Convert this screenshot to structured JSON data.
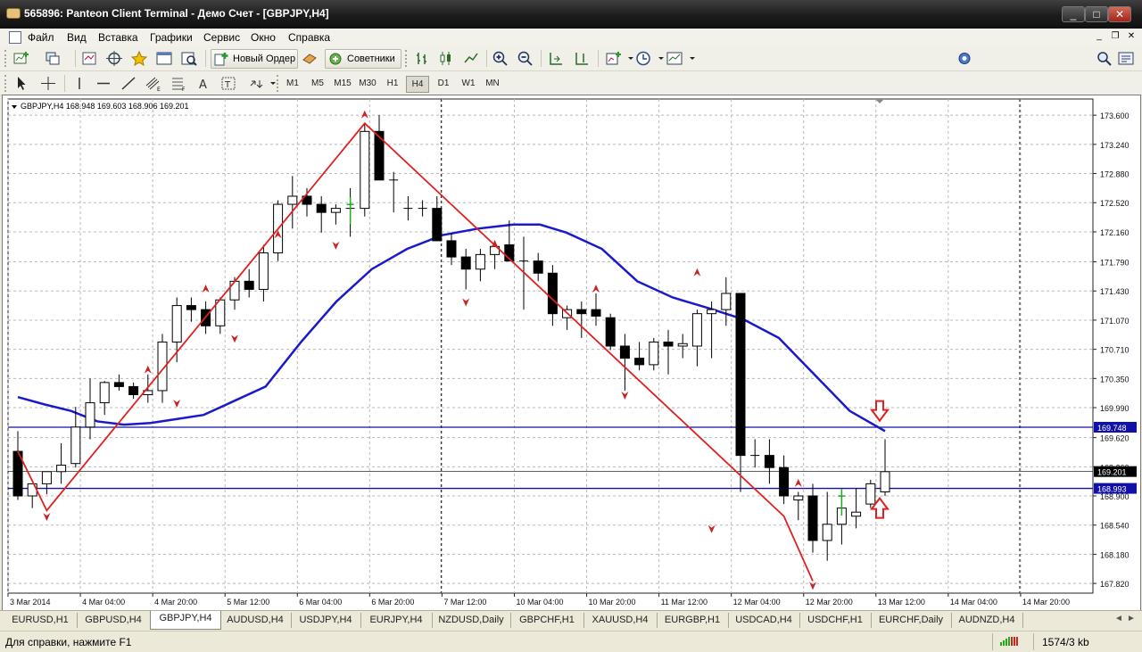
{
  "window": {
    "title": "565896: Panteon Client Terminal - Демо Счет - [GBPJPY,H4]"
  },
  "menu": [
    "Файл",
    "Вид",
    "Вставка",
    "Графики",
    "Сервис",
    "Окно",
    "Справка"
  ],
  "toolbar": {
    "new_order": "Новый Ордер",
    "experts": "Советники",
    "timeframes": [
      "M1",
      "M5",
      "M15",
      "M30",
      "H1",
      "H4",
      "D1",
      "W1",
      "MN"
    ],
    "active_timeframe": "H4"
  },
  "chart": {
    "header": "GBPJPY,H4  168.948 169.603 168.906 169.201",
    "ylim": [
      167.7,
      173.8
    ],
    "y_ticks": [
      "173.600",
      "173.240",
      "172.880",
      "172.520",
      "172.160",
      "171.790",
      "171.430",
      "171.070",
      "170.710",
      "170.350",
      "169.990",
      "169.620",
      "169.260",
      "168.900",
      "168.540",
      "168.180",
      "167.820"
    ],
    "x_ticks": [
      "3 Mar 2014",
      "4 Mar 04:00",
      "4 Mar 20:00",
      "5 Mar 12:00",
      "6 Mar 04:00",
      "6 Mar 20:00",
      "7 Mar 12:00",
      "10 Mar 04:00",
      "10 Mar 20:00",
      "11 Mar 12:00",
      "12 Mar 04:00",
      "12 Mar 20:00",
      "13 Mar 12:00",
      "14 Mar 04:00",
      "14 Mar 20:00"
    ],
    "level_lines": [
      {
        "price": 169.748,
        "label": "169.748",
        "color": "#1111aa"
      },
      {
        "price": 168.993,
        "label": "168.993",
        "color": "#1111aa"
      },
      {
        "price": 169.201,
        "label": "169.201",
        "color": "#000000"
      }
    ],
    "candles": [
      [
        169.45,
        169.7,
        168.85,
        168.9
      ],
      [
        168.9,
        169.05,
        168.75,
        169.05
      ],
      [
        169.05,
        169.2,
        168.92,
        169.2
      ],
      [
        169.2,
        169.55,
        169.05,
        169.28
      ],
      [
        169.3,
        170.0,
        169.25,
        169.75
      ],
      [
        169.75,
        170.35,
        169.6,
        170.05
      ],
      [
        170.05,
        170.32,
        169.9,
        170.3
      ],
      [
        170.3,
        170.4,
        170.2,
        170.25
      ],
      [
        170.25,
        170.3,
        170.1,
        170.15
      ],
      [
        170.15,
        170.4,
        170.05,
        170.2
      ],
      [
        170.2,
        170.9,
        170.05,
        170.8
      ],
      [
        170.8,
        171.35,
        170.55,
        171.25
      ],
      [
        171.25,
        171.35,
        171.05,
        171.2
      ],
      [
        171.2,
        171.3,
        170.9,
        171.0
      ],
      [
        171.0,
        171.35,
        170.9,
        171.32
      ],
      [
        171.32,
        171.6,
        171.2,
        171.55
      ],
      [
        171.55,
        171.7,
        171.35,
        171.45
      ],
      [
        171.45,
        172.0,
        171.3,
        171.9
      ],
      [
        171.9,
        172.55,
        171.8,
        172.5
      ],
      [
        172.5,
        172.85,
        172.2,
        172.6
      ],
      [
        172.6,
        172.7,
        172.35,
        172.5
      ],
      [
        172.5,
        172.6,
        172.15,
        172.4
      ],
      [
        172.4,
        172.5,
        172.25,
        172.45
      ],
      [
        172.45,
        172.7,
        172.1,
        172.45
      ],
      [
        172.45,
        173.5,
        172.35,
        173.4
      ],
      [
        173.4,
        173.6,
        172.9,
        172.8
      ],
      [
        172.8,
        172.9,
        172.4,
        172.8
      ],
      [
        172.45,
        172.6,
        172.3,
        172.45
      ],
      [
        172.45,
        172.55,
        172.35,
        172.45
      ],
      [
        172.45,
        172.6,
        172.05,
        172.05
      ],
      [
        172.05,
        172.15,
        171.75,
        171.85
      ],
      [
        171.85,
        171.95,
        171.45,
        171.7
      ],
      [
        171.7,
        171.95,
        171.55,
        171.88
      ],
      [
        171.88,
        172.05,
        171.7,
        171.98
      ],
      [
        172.0,
        172.3,
        171.85,
        171.8
      ],
      [
        171.8,
        172.1,
        171.2,
        171.8
      ],
      [
        171.8,
        171.9,
        171.55,
        171.65
      ],
      [
        171.65,
        171.75,
        171.0,
        171.15
      ],
      [
        171.1,
        171.25,
        170.95,
        171.2
      ],
      [
        171.2,
        171.3,
        170.85,
        171.15
      ],
      [
        171.2,
        171.4,
        171.0,
        171.12
      ],
      [
        171.1,
        171.15,
        170.7,
        170.75
      ],
      [
        170.75,
        170.9,
        170.2,
        170.6
      ],
      [
        170.6,
        170.8,
        170.45,
        170.52
      ],
      [
        170.52,
        170.85,
        170.45,
        170.8
      ],
      [
        170.8,
        170.95,
        170.4,
        170.75
      ],
      [
        170.75,
        170.9,
        170.6,
        170.78
      ],
      [
        170.75,
        171.2,
        170.5,
        171.15
      ],
      [
        171.15,
        171.3,
        170.6,
        171.2
      ],
      [
        171.2,
        171.6,
        171.0,
        171.4
      ],
      [
        171.4,
        171.4,
        168.95,
        169.4
      ],
      [
        169.4,
        169.6,
        169.25,
        169.4
      ],
      [
        169.4,
        169.6,
        169.05,
        169.25
      ],
      [
        169.25,
        169.4,
        168.8,
        168.9
      ],
      [
        168.85,
        168.95,
        168.6,
        168.9
      ],
      [
        168.9,
        169.05,
        168.2,
        168.35
      ],
      [
        168.35,
        168.95,
        168.1,
        168.55
      ],
      [
        168.55,
        168.95,
        168.3,
        168.75
      ],
      [
        168.65,
        169.0,
        168.5,
        168.7
      ],
      [
        168.8,
        169.1,
        168.75,
        169.05
      ],
      [
        168.95,
        169.6,
        168.9,
        169.2
      ]
    ],
    "moving_average": [
      [
        0,
        170.12
      ],
      [
        3,
        170.03
      ],
      [
        6,
        169.95
      ],
      [
        9,
        169.82
      ],
      [
        12,
        169.78
      ],
      [
        15,
        169.8
      ],
      [
        18,
        169.85
      ],
      [
        21,
        169.9
      ],
      [
        24,
        170.05
      ],
      [
        28,
        170.25
      ],
      [
        32,
        170.8
      ],
      [
        36,
        171.3
      ],
      [
        40,
        171.7
      ],
      [
        44,
        171.95
      ],
      [
        48,
        172.12
      ],
      [
        52,
        172.2
      ],
      [
        56,
        172.25
      ],
      [
        59,
        172.25
      ],
      [
        62,
        172.15
      ],
      [
        66,
        171.95
      ],
      [
        70,
        171.55
      ],
      [
        74,
        171.35
      ],
      [
        78,
        171.22
      ],
      [
        82,
        171.08
      ],
      [
        86,
        170.85
      ],
      [
        90,
        170.4
      ],
      [
        94,
        169.95
      ],
      [
        98,
        169.7
      ]
    ],
    "zigzag": [
      [
        0,
        169.45
      ],
      [
        2,
        168.72
      ],
      [
        24,
        173.5
      ],
      [
        53,
        168.65
      ],
      [
        55,
        167.85
      ]
    ],
    "fractals_up": [
      [
        9,
        170.4
      ],
      [
        13,
        171.4
      ],
      [
        18,
        172.07
      ],
      [
        24,
        173.55
      ],
      [
        33,
        171.95
      ],
      [
        40,
        171.4
      ],
      [
        47,
        171.6
      ],
      [
        54,
        169.0
      ]
    ],
    "fractals_down": [
      [
        2,
        168.7
      ],
      [
        11,
        170.1
      ],
      [
        15,
        170.9
      ],
      [
        22,
        172.05
      ],
      [
        31,
        171.35
      ],
      [
        42,
        170.2
      ],
      [
        48,
        168.55
      ],
      [
        55,
        167.85
      ]
    ],
    "big_arrow_down_price": 169.95,
    "big_arrow_up_price": 168.75
  },
  "symbol_tabs": [
    "EURUSD,H1",
    "GBPUSD,H4",
    "GBPJPY,H4",
    "AUDUSD,H4",
    "USDJPY,H4",
    "EURJPY,H4",
    "NZDUSD,Daily",
    "GBPCHF,H1",
    "XAUUSD,H4",
    "EURGBP,H1",
    "USDCAD,H4",
    "USDCHF,H1",
    "EURCHF,Daily",
    "AUDNZD,H4"
  ],
  "active_tab": "GBPJPY,H4",
  "status": {
    "help": "Для справки, нажмите F1",
    "traffic": "1574/3 kb"
  },
  "colors": {
    "zigzag": "#e02020",
    "ma": "#1a1acc",
    "fractal": "#cc2222",
    "up_arrow": "#22aa22",
    "level": "#1111aa"
  }
}
